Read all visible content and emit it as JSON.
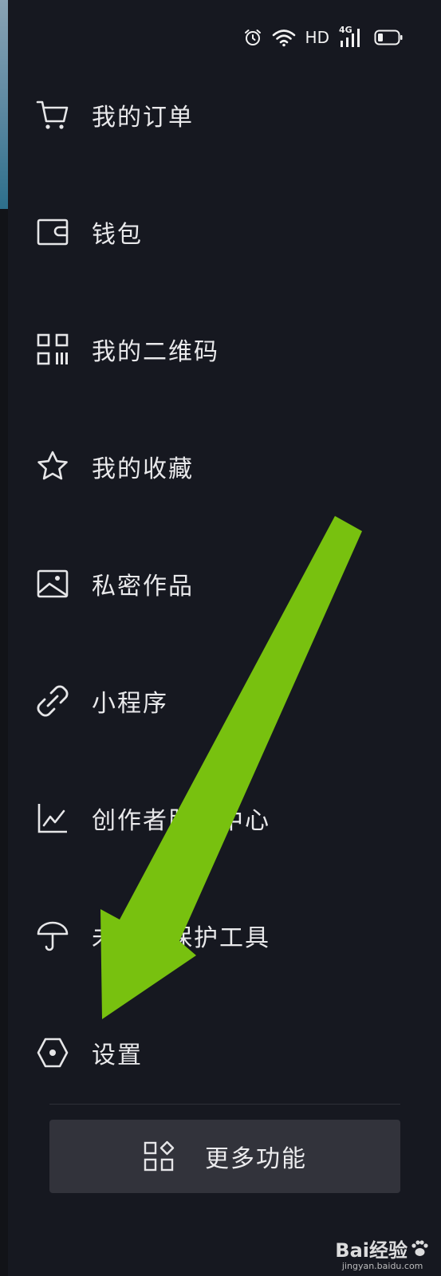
{
  "status_bar": {
    "network_label": "HD",
    "signal_label": "4G",
    "icons": [
      "alarm-icon",
      "wifi-icon",
      "signal-icon",
      "battery-icon"
    ]
  },
  "menu": {
    "items": [
      {
        "label": "我的订单",
        "icon": "cart-icon"
      },
      {
        "label": "钱包",
        "icon": "wallet-icon"
      },
      {
        "label": "我的二维码",
        "icon": "qrcode-icon"
      },
      {
        "label": "我的收藏",
        "icon": "star-icon"
      },
      {
        "label": "私密作品",
        "icon": "image-icon"
      },
      {
        "label": "小程序",
        "icon": "link-icon"
      },
      {
        "label": "创作者服务中心",
        "icon": "chart-icon"
      },
      {
        "label": "未成年保护工具",
        "icon": "umbrella-icon"
      },
      {
        "label": "设置",
        "icon": "hexagon-settings-icon"
      }
    ]
  },
  "more_button": {
    "label": "更多功能",
    "icon": "apps-icon"
  },
  "overlay": {
    "arrow_color": "#78c10f"
  },
  "watermark": {
    "brand": "Bai经验",
    "url": "jingyan.baidu.com"
  },
  "colors": {
    "background": "#161820",
    "text": "#e9e9eb",
    "button_bg": "#32333b"
  }
}
